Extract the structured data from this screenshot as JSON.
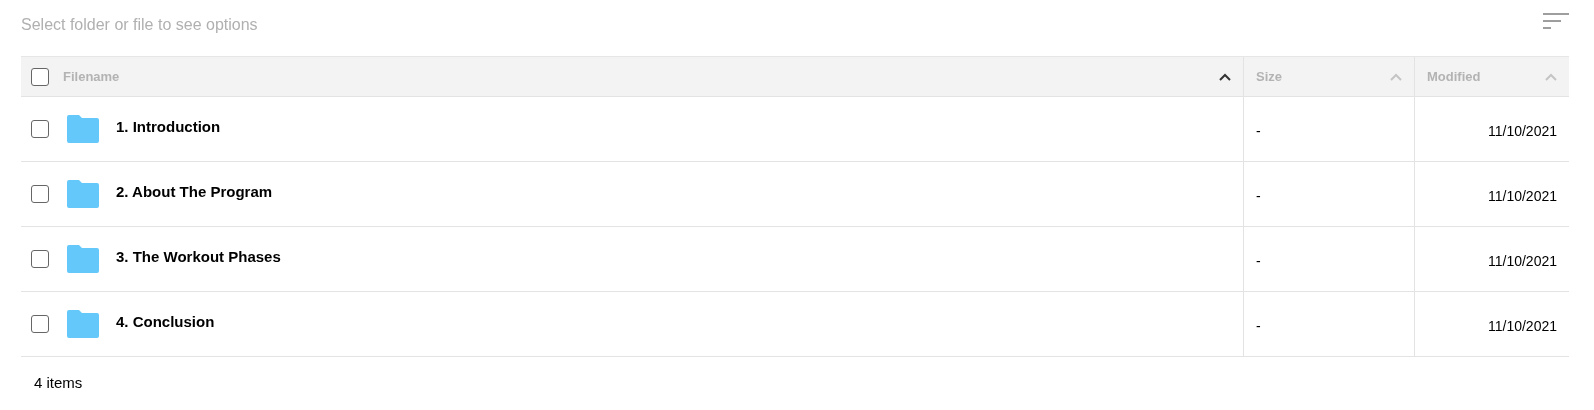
{
  "toolbar": {
    "hint": "Select folder or file to see options"
  },
  "table": {
    "select_all": {
      "checked": false
    },
    "columns": [
      {
        "label": "Filename",
        "sorted": true
      },
      {
        "label": "Size",
        "sorted": false
      },
      {
        "label": "Modified",
        "sorted": false
      }
    ],
    "rows": [
      {
        "checked": false,
        "name": "1. Introduction",
        "size": "-",
        "modified": "11/10/2021"
      },
      {
        "checked": false,
        "name": "2. About The Program",
        "size": "-",
        "modified": "11/10/2021"
      },
      {
        "checked": false,
        "name": "3. The Workout Phases",
        "size": "-",
        "modified": "11/10/2021"
      },
      {
        "checked": false,
        "name": "4. Conclusion",
        "size": "-",
        "modified": "11/10/2021"
      }
    ]
  },
  "footer": {
    "count": "4 items"
  }
}
